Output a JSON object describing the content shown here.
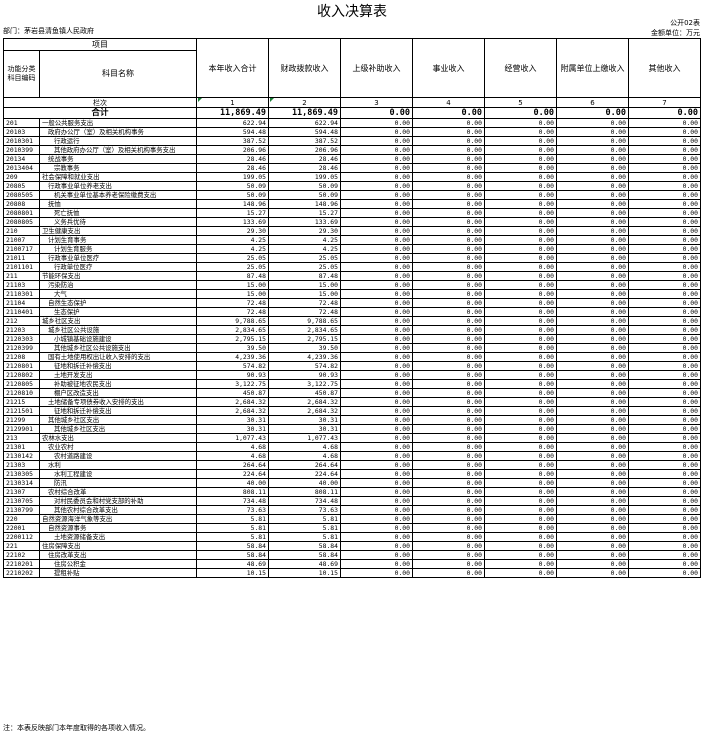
{
  "title": "收入决算表",
  "meta": {
    "department": "部门：茅岩县清鱼镇人民政府",
    "form_no": "公开02表",
    "unit": "金额单位：万元"
  },
  "header": {
    "item": "项目",
    "code": "功能分类科目编码",
    "name": "科目名称",
    "columns": [
      "本年收入合计",
      "财政拨款收入",
      "上级补助收入",
      "事业收入",
      "经营收入",
      "附属单位上缴收入",
      "其他收入"
    ],
    "index_label": "栏次",
    "indices": [
      "1",
      "2",
      "3",
      "4",
      "5",
      "6",
      "7"
    ]
  },
  "total": {
    "label": "合计",
    "values": [
      "11,869.49",
      "11,869.49",
      "0.00",
      "0.00",
      "0.00",
      "0.00",
      "0.00"
    ]
  },
  "rows": [
    {
      "code": "201",
      "name": "一般公共服务支出",
      "level": 1,
      "a": "622.94",
      "b": "622.94"
    },
    {
      "code": "20103",
      "name": "政府办公厅（室）及相关机构事务",
      "level": 2,
      "a": "594.48",
      "b": "594.48"
    },
    {
      "code": "2010301",
      "name": "行政运行",
      "level": 3,
      "a": "387.52",
      "b": "387.52"
    },
    {
      "code": "2010399",
      "name": "其他政府办公厅（室）及相关机构事务支出",
      "level": 3,
      "a": "206.96",
      "b": "206.96"
    },
    {
      "code": "20134",
      "name": "统战事务",
      "level": 2,
      "a": "28.46",
      "b": "28.46"
    },
    {
      "code": "2013404",
      "name": "宗教事务",
      "level": 3,
      "a": "28.46",
      "b": "28.46"
    },
    {
      "code": "209",
      "name": "社会保障和就业支出",
      "level": 1,
      "a": "199.05",
      "b": "199.05"
    },
    {
      "code": "20805",
      "name": "行政事业单位养老支出",
      "level": 2,
      "a": "50.09",
      "b": "50.09"
    },
    {
      "code": "2080505",
      "name": "机关事业单位基本养老保险缴费支出",
      "level": 3,
      "a": "50.09",
      "b": "50.09"
    },
    {
      "code": "20808",
      "name": "抚恤",
      "level": 2,
      "a": "148.96",
      "b": "148.96"
    },
    {
      "code": "2080801",
      "name": "死亡抚恤",
      "level": 3,
      "a": "15.27",
      "b": "15.27"
    },
    {
      "code": "2080805",
      "name": "义务兵优待",
      "level": 3,
      "a": "133.69",
      "b": "133.69"
    },
    {
      "code": "210",
      "name": "卫生健康支出",
      "level": 1,
      "a": "29.30",
      "b": "29.30"
    },
    {
      "code": "21007",
      "name": "计划生育事务",
      "level": 2,
      "a": "4.25",
      "b": "4.25"
    },
    {
      "code": "2100717",
      "name": "计划生育服务",
      "level": 3,
      "a": "4.25",
      "b": "4.25"
    },
    {
      "code": "21011",
      "name": "行政事业单位医疗",
      "level": 2,
      "a": "25.05",
      "b": "25.05"
    },
    {
      "code": "2101101",
      "name": "行政单位医疗",
      "level": 3,
      "a": "25.05",
      "b": "25.05"
    },
    {
      "code": "211",
      "name": "节能环保支出",
      "level": 1,
      "a": "87.48",
      "b": "87.48"
    },
    {
      "code": "21103",
      "name": "污染防治",
      "level": 2,
      "a": "15.00",
      "b": "15.00"
    },
    {
      "code": "2110301",
      "name": "大气",
      "level": 3,
      "a": "15.00",
      "b": "15.00"
    },
    {
      "code": "21104",
      "name": "自然生态保护",
      "level": 2,
      "a": "72.48",
      "b": "72.48"
    },
    {
      "code": "2110401",
      "name": "生态保护",
      "level": 3,
      "a": "72.48",
      "b": "72.48"
    },
    {
      "code": "212",
      "name": "城乡社区支出",
      "level": 1,
      "a": "9,788.65",
      "b": "9,788.65"
    },
    {
      "code": "21203",
      "name": "城乡社区公共设施",
      "level": 2,
      "a": "2,834.65",
      "b": "2,834.65"
    },
    {
      "code": "2120303",
      "name": "小城镇基础设施建设",
      "level": 3,
      "a": "2,795.15",
      "b": "2,795.15"
    },
    {
      "code": "2120399",
      "name": "其他城乡社区公共设施支出",
      "level": 3,
      "a": "39.50",
      "b": "39.50"
    },
    {
      "code": "21208",
      "name": "国有土地使用权出让收入安排的支出",
      "level": 2,
      "a": "4,239.36",
      "b": "4,239.36"
    },
    {
      "code": "2120801",
      "name": "征地和拆迁补偿支出",
      "level": 3,
      "a": "574.82",
      "b": "574.82"
    },
    {
      "code": "2120802",
      "name": "土地开发支出",
      "level": 3,
      "a": "90.93",
      "b": "90.93"
    },
    {
      "code": "2120805",
      "name": "补助被征地农民支出",
      "level": 3,
      "a": "3,122.75",
      "b": "3,122.75"
    },
    {
      "code": "2120810",
      "name": "棚户区改造支出",
      "level": 3,
      "a": "450.87",
      "b": "450.87"
    },
    {
      "code": "21215",
      "name": "土地储备专项债券收入安排的支出",
      "level": 2,
      "a": "2,684.32",
      "b": "2,684.32"
    },
    {
      "code": "2121501",
      "name": "征地和拆迁补偿支出",
      "level": 3,
      "a": "2,684.32",
      "b": "2,684.32"
    },
    {
      "code": "21299",
      "name": "其他城乡社区支出",
      "level": 2,
      "a": "30.31",
      "b": "30.31"
    },
    {
      "code": "2129901",
      "name": "其他城乡社区支出",
      "level": 3,
      "a": "30.31",
      "b": "30.31"
    },
    {
      "code": "213",
      "name": "农林水支出",
      "level": 1,
      "a": "1,077.43",
      "b": "1,077.43"
    },
    {
      "code": "21301",
      "name": "农业农村",
      "level": 2,
      "a": "4.68",
      "b": "4.68"
    },
    {
      "code": "2130142",
      "name": "农村道路建设",
      "level": 3,
      "a": "4.68",
      "b": "4.68"
    },
    {
      "code": "21303",
      "name": "水利",
      "level": 2,
      "a": "264.64",
      "b": "264.64"
    },
    {
      "code": "2130305",
      "name": "水利工程建设",
      "level": 3,
      "a": "224.64",
      "b": "224.64"
    },
    {
      "code": "2130314",
      "name": "防汛",
      "level": 3,
      "a": "40.00",
      "b": "40.00"
    },
    {
      "code": "21307",
      "name": "农村综合改革",
      "level": 2,
      "a": "808.11",
      "b": "808.11"
    },
    {
      "code": "2130705",
      "name": "对村民委员会和村党支部的补助",
      "level": 3,
      "a": "734.48",
      "b": "734.48"
    },
    {
      "code": "2130799",
      "name": "其他农村综合改革支出",
      "level": 3,
      "a": "73.63",
      "b": "73.63"
    },
    {
      "code": "220",
      "name": "自然资源海洋气象等支出",
      "level": 1,
      "a": "5.81",
      "b": "5.81"
    },
    {
      "code": "22001",
      "name": "自然资源事务",
      "level": 2,
      "a": "5.81",
      "b": "5.81"
    },
    {
      "code": "2200112",
      "name": "土地资源储备支出",
      "level": 3,
      "a": "5.81",
      "b": "5.81"
    },
    {
      "code": "221",
      "name": "住房保障支出",
      "level": 1,
      "a": "58.84",
      "b": "58.84"
    },
    {
      "code": "22102",
      "name": "住房改革支出",
      "level": 2,
      "a": "58.84",
      "b": "58.84"
    },
    {
      "code": "2210201",
      "name": "住房公积金",
      "level": 3,
      "a": "48.69",
      "b": "48.69"
    },
    {
      "code": "2210202",
      "name": "提租补贴",
      "level": 3,
      "a": "10.15",
      "b": "10.15"
    }
  ],
  "zero_value": "0.00",
  "note": "注：本表反映部门本年度取得的各项收入情况。"
}
